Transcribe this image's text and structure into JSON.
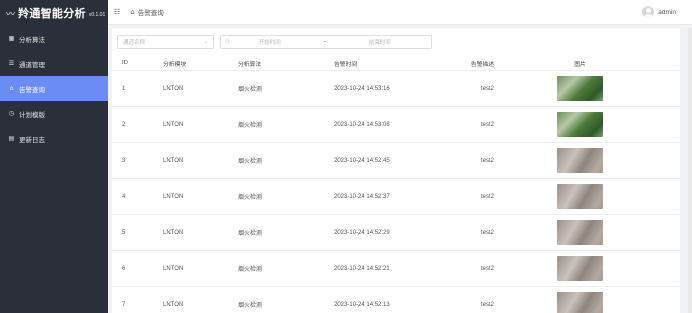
{
  "app": {
    "logo_icon": "〰",
    "title": "羚通智能分析",
    "version": "v0.1.01"
  },
  "sidebar": {
    "items": [
      {
        "label": "分析算法",
        "icon": "grid-icon",
        "glyph": "▦",
        "active": false
      },
      {
        "label": "通道管理",
        "icon": "list-icon",
        "glyph": "☰",
        "active": false
      },
      {
        "label": "告警查询",
        "icon": "home-icon",
        "glyph": "⌂",
        "active": true
      },
      {
        "label": "计划模版",
        "icon": "clock-icon",
        "glyph": "◷",
        "active": false
      },
      {
        "label": "更新日志",
        "icon": "document-icon",
        "glyph": "▤",
        "active": false
      }
    ]
  },
  "topbar": {
    "menu_glyph": "☷",
    "home_glyph": "⌂",
    "breadcrumb": "告警查询",
    "username": "admin"
  },
  "filters": {
    "channel_placeholder": "通道名称",
    "caret_glyph": "⌄",
    "clock_glyph": "◷",
    "start_placeholder": "开始时间",
    "separator": "-",
    "end_placeholder": "结束时间"
  },
  "table": {
    "headers": {
      "id": "ID",
      "module": "分析模块",
      "algorithm": "分析算法",
      "time": "告警时间",
      "desc": "告警描述",
      "image": "图片"
    },
    "rows": [
      {
        "id": "1",
        "module": "LNTON",
        "algorithm": "烟火检测",
        "time": "2023-10-24 14:53:16",
        "desc": "test2",
        "image": "green"
      },
      {
        "id": "2",
        "module": "LNTON",
        "algorithm": "烟火检测",
        "time": "2023-10-24 14:53:08",
        "desc": "test2",
        "image": "green"
      },
      {
        "id": "3",
        "module": "LNTON",
        "algorithm": "烟火检测",
        "time": "2023-10-24 14:52:45",
        "desc": "test2",
        "image": "smoke"
      },
      {
        "id": "4",
        "module": "LNTON",
        "algorithm": "烟火检测",
        "time": "2023-10-24 14:52:37",
        "desc": "test2",
        "image": "smoke"
      },
      {
        "id": "5",
        "module": "LNTON",
        "algorithm": "烟火检测",
        "time": "2023-10-24 14:52:29",
        "desc": "test2",
        "image": "smoke"
      },
      {
        "id": "6",
        "module": "LNTON",
        "algorithm": "烟火检测",
        "time": "2023-10-24 14:52:21",
        "desc": "test2",
        "image": "smoke"
      },
      {
        "id": "7",
        "module": "LNTON",
        "algorithm": "烟火检测",
        "time": "2023-10-24 14:52:13",
        "desc": "test2",
        "image": "smoke"
      }
    ]
  },
  "colors": {
    "sidebar_bg": "#2b2f3a",
    "active_item": "#6b8bf5"
  }
}
